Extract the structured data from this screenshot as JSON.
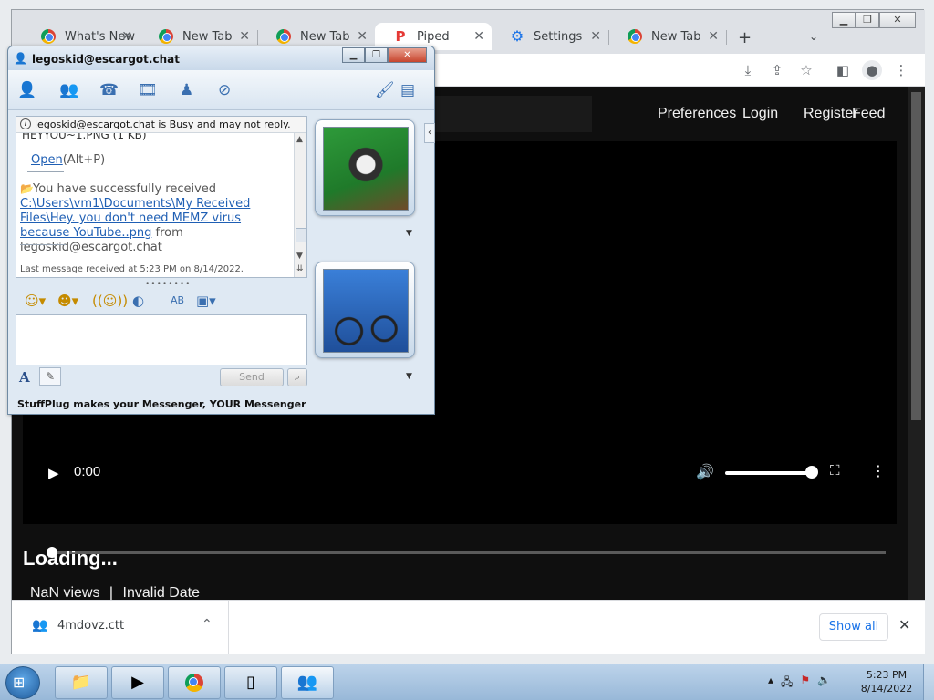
{
  "browser": {
    "tabs": [
      {
        "label": "What's New",
        "icon": "chrome-icon"
      },
      {
        "label": "New Tab",
        "icon": "chrome-icon"
      },
      {
        "label": "New Tab",
        "icon": "chrome-icon"
      },
      {
        "label": "Piped",
        "icon": "piped-icon",
        "active": true
      },
      {
        "label": "Settings",
        "icon": "gear-icon"
      },
      {
        "label": "New Tab",
        "icon": "chrome-icon"
      }
    ],
    "new_tab_symbol": "+",
    "tab_close_symbol": "✕"
  },
  "piped": {
    "nav": [
      "Preferences",
      "Login",
      "Register",
      "Feed"
    ],
    "player_time": "0:00",
    "video_title": "Loading...",
    "views": "NaN views",
    "separator": "|",
    "date": "Invalid Date"
  },
  "download_shelf": {
    "filename": "4mdovz.ctt",
    "show_all": "Show all"
  },
  "messenger": {
    "title": "legoskid@escargot.chat",
    "busy_notice": "legoskid@escargot.chat is Busy and may not reply.",
    "prev_file_line": "HEYYOU~1.PNG (1 KB)",
    "open_link": "Open",
    "open_shortcut": "(Alt+P)",
    "recv_prefix": "You have successfully received",
    "recv_path": "C:\\Users\\vm1\\Documents\\My Received Files\\Hey. you don't need MEMZ virus because YouTube..png",
    "recv_from": "from",
    "recv_sender": "legoskid@escargot.chat",
    "last_message": "Last message received at 5:23 PM on 8/14/2022.",
    "send_label": "Send",
    "footer": "StuffPlug makes your Messenger, YOUR Messenger"
  },
  "taskbar": {
    "clock_time": "5:23 PM",
    "clock_date": "8/14/2022"
  },
  "colors": {
    "page_bg": "#0f0f0f",
    "link_blue": "#1f5fb4",
    "chrome_accent": "#1a73e8"
  }
}
